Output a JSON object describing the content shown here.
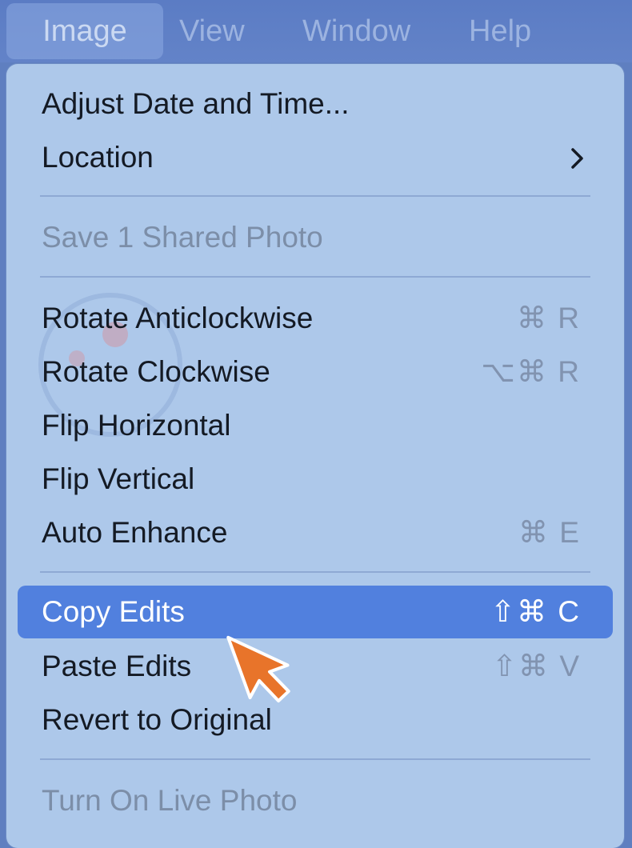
{
  "menubar": {
    "items": [
      "Image",
      "View",
      "Window",
      "Help"
    ]
  },
  "menu": {
    "adjust_date": "Adjust Date and Time...",
    "location": "Location",
    "save_shared": "Save 1 Shared Photo",
    "rotate_anti": {
      "label": "Rotate Anticlockwise",
      "shortcut": "⌘ R"
    },
    "rotate_clock": {
      "label": "Rotate Clockwise",
      "shortcut": "⌥⌘ R"
    },
    "flip_h": "Flip Horizontal",
    "flip_v": "Flip Vertical",
    "auto_enhance": {
      "label": "Auto Enhance",
      "shortcut": "⌘ E"
    },
    "copy_edits": {
      "label": "Copy Edits",
      "shortcut": "⇧⌘ C"
    },
    "paste_edits": {
      "label": "Paste Edits",
      "shortcut": "⇧⌘ V"
    },
    "revert": "Revert to Original",
    "live_photo": "Turn On Live Photo"
  },
  "colors": {
    "menubar": "#5f7fc0",
    "menu_bg": "#adc8ea",
    "highlight": "#5180de",
    "cursor": "#e8742a"
  },
  "icons": {
    "submenu": "chevron-right-icon",
    "pointer": "arrow-cursor-icon"
  }
}
